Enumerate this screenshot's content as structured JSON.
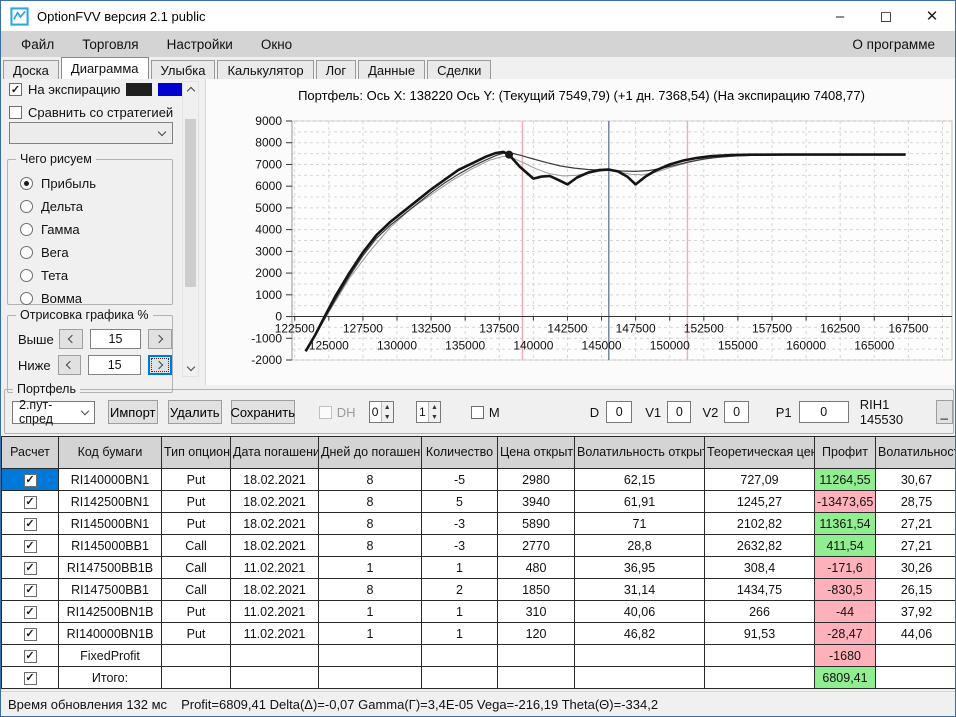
{
  "window": {
    "title": "OptionFVV версия 2.1 public",
    "minimize": "–",
    "maximize": "◻",
    "close": "✕"
  },
  "menu": {
    "file": "Файл",
    "trading": "Торговля",
    "settings": "Настройки",
    "win": "Окно",
    "about": "О программе"
  },
  "tabs": {
    "items": [
      "Доска",
      "Диаграмма",
      "Улыбка",
      "Калькулятор",
      "Лог",
      "Данные",
      "Сделки"
    ],
    "active": "Диаграмма"
  },
  "sidebar": {
    "expiration_label": "На экспирацию",
    "compare_label": "Сравнить со стратегией",
    "strategy_value": "",
    "draw_group": {
      "title": "Чего рисуем",
      "options": [
        "Прибыль",
        "Дельта",
        "Гамма",
        "Вега",
        "Тета",
        "Вомма"
      ],
      "selected": "Прибыль"
    },
    "render_group": {
      "title": "Отрисовка графика %",
      "above_label": "Выше",
      "above_value": "15",
      "below_label": "Ниже",
      "below_value": "15"
    }
  },
  "colors": {
    "swatch_black": "#1f1f1f",
    "swatch_blue": "#0000cf",
    "profit_positive": "#90ee90",
    "profit_negative": "#ffb1bb",
    "selection_blue": "#0078d7",
    "strike_line_pink": "#f2aab5",
    "price_line_gray": "#6e7f95"
  },
  "chart_title": "Портфель: Ось X: 138220 Ось Y:  (Текущий 7549,79)  (+1 дн. 7368,54)  (На экспирацию 7408,77)",
  "chart_data": {
    "type": "line",
    "title": "Портфель",
    "crosshair_x": 138220,
    "values_at_crosshair": {
      "current": "7549,79",
      "plus_1_day": "7368,54",
      "at_expiration": "7408,77"
    },
    "x_range": [
      122300,
      170700
    ],
    "y_range": [
      -2000,
      9000
    ],
    "x_grid_step": 2500,
    "y_grid_step": 500,
    "y_ticks": [
      9000,
      8000,
      7000,
      6000,
      5000,
      4000,
      3000,
      2000,
      1000,
      0,
      -1000,
      -2000
    ],
    "x_ticks_row1": [
      122500,
      127500,
      132500,
      137500,
      142500,
      147500,
      152500,
      157500,
      162500,
      167500
    ],
    "x_ticks_row2": [
      125000,
      130000,
      135000,
      140000,
      145000,
      150000,
      155000,
      160000,
      165000
    ],
    "v_lines": [
      {
        "x": 139200,
        "color": "#f2aab5"
      },
      {
        "x": 145530,
        "color": "#6e7f95"
      },
      {
        "x": 151300,
        "color": "#f2aab5"
      }
    ],
    "marker": {
      "x": 138220,
      "y": 7450
    },
    "series": [
      {
        "name": "На экспирацию",
        "color": "#141414",
        "width": 2.6,
        "points": [
          [
            123300,
            -1600
          ],
          [
            124000,
            -850
          ],
          [
            124700,
            0
          ],
          [
            125500,
            950
          ],
          [
            126500,
            2000
          ],
          [
            127500,
            2950
          ],
          [
            128500,
            3750
          ],
          [
            129500,
            4350
          ],
          [
            130500,
            4850
          ],
          [
            131500,
            5350
          ],
          [
            132500,
            5850
          ],
          [
            133500,
            6300
          ],
          [
            134500,
            6750
          ],
          [
            135500,
            7050
          ],
          [
            136500,
            7350
          ],
          [
            137200,
            7520
          ],
          [
            137800,
            7580
          ],
          [
            138220,
            7450
          ],
          [
            139000,
            6900
          ],
          [
            140000,
            6350
          ],
          [
            140600,
            6440
          ],
          [
            141200,
            6470
          ],
          [
            141800,
            6300
          ],
          [
            142500,
            6080
          ],
          [
            143200,
            6400
          ],
          [
            144000,
            6620
          ],
          [
            144800,
            6740
          ],
          [
            145500,
            6770
          ],
          [
            146200,
            6680
          ],
          [
            146900,
            6430
          ],
          [
            147500,
            6080
          ],
          [
            148200,
            6430
          ],
          [
            149000,
            6730
          ],
          [
            150000,
            7000
          ],
          [
            151000,
            7180
          ],
          [
            152000,
            7300
          ],
          [
            153000,
            7380
          ],
          [
            154500,
            7430
          ],
          [
            156000,
            7450
          ],
          [
            158500,
            7455
          ],
          [
            161000,
            7455
          ],
          [
            164000,
            7455
          ],
          [
            167300,
            7455
          ]
        ]
      },
      {
        "name": "Текущий",
        "color": "#3c3c3c",
        "width": 1.2,
        "points": [
          [
            123400,
            -1500
          ],
          [
            124500,
            -300
          ],
          [
            125500,
            800
          ],
          [
            126500,
            1850
          ],
          [
            127500,
            2800
          ],
          [
            128500,
            3600
          ],
          [
            129500,
            4200
          ],
          [
            130500,
            4700
          ],
          [
            131500,
            5200
          ],
          [
            132500,
            5700
          ],
          [
            133500,
            6150
          ],
          [
            134500,
            6550
          ],
          [
            135500,
            6900
          ],
          [
            136500,
            7200
          ],
          [
            137300,
            7420
          ],
          [
            137900,
            7530
          ],
          [
            138220,
            7550
          ],
          [
            139000,
            7430
          ],
          [
            140000,
            7250
          ],
          [
            141000,
            7080
          ],
          [
            142000,
            6930
          ],
          [
            143000,
            6830
          ],
          [
            144000,
            6770
          ],
          [
            145000,
            6740
          ],
          [
            145530,
            6730
          ],
          [
            146500,
            6700
          ],
          [
            147500,
            6680
          ],
          [
            148500,
            6720
          ],
          [
            149500,
            6830
          ],
          [
            150500,
            6980
          ],
          [
            151500,
            7130
          ],
          [
            152500,
            7250
          ],
          [
            153500,
            7330
          ],
          [
            155000,
            7400
          ],
          [
            157000,
            7440
          ],
          [
            159000,
            7450
          ],
          [
            162000,
            7455
          ],
          [
            165000,
            7458
          ],
          [
            167300,
            7460
          ]
        ]
      },
      {
        "name": "+1 дн.",
        "color": "#9a9a9a",
        "width": 1,
        "points": [
          [
            123400,
            -1550
          ],
          [
            125000,
            200
          ],
          [
            126500,
            1750
          ],
          [
            128000,
            3000
          ],
          [
            129500,
            4100
          ],
          [
            131000,
            4950
          ],
          [
            132500,
            5600
          ],
          [
            134000,
            6250
          ],
          [
            135500,
            6800
          ],
          [
            136800,
            7200
          ],
          [
            137800,
            7370
          ],
          [
            138220,
            7370
          ],
          [
            139200,
            7100
          ],
          [
            140200,
            6800
          ],
          [
            141200,
            6570
          ],
          [
            142200,
            6470
          ],
          [
            143200,
            6500
          ],
          [
            144200,
            6620
          ],
          [
            145000,
            6700
          ],
          [
            145530,
            6720
          ],
          [
            146300,
            6650
          ],
          [
            147200,
            6540
          ],
          [
            148000,
            6520
          ],
          [
            149000,
            6650
          ],
          [
            150000,
            6850
          ],
          [
            151000,
            7030
          ],
          [
            152000,
            7180
          ],
          [
            153000,
            7290
          ],
          [
            154500,
            7380
          ],
          [
            156500,
            7430
          ],
          [
            159000,
            7450
          ],
          [
            162000,
            7455
          ],
          [
            165000,
            7458
          ],
          [
            167300,
            7460
          ]
        ]
      }
    ]
  },
  "portfolio": {
    "group_title": "Портфель",
    "strategy_value": "2.пут-спред",
    "import_label": "Импорт",
    "delete_label": "Удалить",
    "save_label": "Сохранить",
    "dh_label": "DH",
    "spin1_value": "0",
    "spin2_value": "1",
    "m_label": "M",
    "d_label": "D",
    "d_value": "0",
    "v1_label": "V1",
    "v1_value": "0",
    "v2_label": "V2",
    "v2_value": "0",
    "p1_label": "P1",
    "p1_value": "0",
    "instrument": "RIH1 145530",
    "collapse_label": "_"
  },
  "table": {
    "headers": [
      "Расчет",
      "Код бумаги",
      "Тип опциона",
      "Дата погашения",
      "Дней до погашения",
      "Количество",
      "Цена открытия",
      "Волатильность открытия",
      "Теоретическая цена",
      "Профит",
      "Волатильность"
    ],
    "rows": [
      [
        "RI140000BN1",
        "Put",
        "18.02.2021",
        "8",
        "-5",
        "2980",
        "62,15",
        "727,09",
        "11264,55",
        "30,67"
      ],
      [
        "RI142500BN1",
        "Put",
        "18.02.2021",
        "8",
        "5",
        "3940",
        "61,91",
        "1245,27",
        "-13473,65",
        "28,75"
      ],
      [
        "RI145000BN1",
        "Put",
        "18.02.2021",
        "8",
        "-3",
        "5890",
        "71",
        "2102,82",
        "11361,54",
        "27,21"
      ],
      [
        "RI145000BB1",
        "Call",
        "18.02.2021",
        "8",
        "-3",
        "2770",
        "28,8",
        "2632,82",
        "411,54",
        "27,21"
      ],
      [
        "RI147500BB1B",
        "Call",
        "11.02.2021",
        "1",
        "1",
        "480",
        "36,95",
        "308,4",
        "-171,6",
        "30,26"
      ],
      [
        "RI147500BB1",
        "Call",
        "18.02.2021",
        "8",
        "2",
        "1850",
        "31,14",
        "1434,75",
        "-830,5",
        "26,15"
      ],
      [
        "RI142500BN1B",
        "Put",
        "11.02.2021",
        "1",
        "1",
        "310",
        "40,06",
        "266",
        "-44",
        "37,92"
      ],
      [
        "RI140000BN1B",
        "Put",
        "11.02.2021",
        "1",
        "1",
        "120",
        "46,82",
        "91,53",
        "-28,47",
        "44,06"
      ],
      [
        "FixedProfit",
        "",
        "",
        "",
        "",
        "",
        "",
        "",
        "-1680",
        ""
      ],
      [
        "Итого:",
        "",
        "",
        "",
        "",
        "",
        "",
        "",
        "6809,41",
        ""
      ]
    ],
    "profit_colors": [
      "green",
      "red",
      "green",
      "green",
      "red",
      "red",
      "red",
      "red",
      "red",
      "green"
    ]
  },
  "status": {
    "update_time": "Время обновления 132 мс",
    "metrics": "Profit=6809,41 Delta(Δ)=-0,07 Gamma(Γ)=3,4E-05 Vega=-216,19 Theta(Θ)=-334,2"
  }
}
